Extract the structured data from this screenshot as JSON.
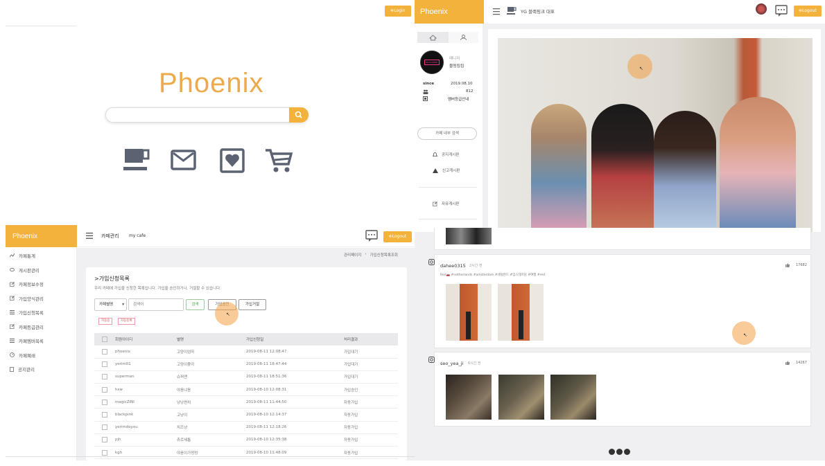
{
  "panelA": {
    "login_label": "Login",
    "logo_text": "Phoenix",
    "search_placeholder": "",
    "icons": [
      "coffee-cup-icon",
      "mail-icon",
      "heart-card-icon",
      "cart-icon"
    ]
  },
  "panelB": {
    "brand": "Phoenix",
    "cafe_title": "YG 블랙핑크 대표",
    "logout_label": "Logout",
    "tabs": [
      "home-icon",
      "user-icon"
    ],
    "role_label": "매니저",
    "nickname": "블링킴킴",
    "since_label": "since",
    "since_date": "2019.08.10",
    "member_count": "812",
    "grade_link": "멤버등급안내",
    "search_button": "카페 내부 검색",
    "board_notice": "공지게시판",
    "board_report": "신고게시판",
    "board_free": "자유게시판"
  },
  "panelC": {
    "brand": "Phoenix",
    "header_title": "카페관리",
    "header_sub": "my cafe",
    "logout_label": "Logout",
    "menu": [
      "카페통계",
      "게시판관리",
      "카페정보수정",
      "가입양식관리",
      "가입신청목록",
      "카페등급관리",
      "카페멤버목록",
      "카페폐쇄",
      "공지관리"
    ],
    "breadcrumb_1": "관리페이지",
    "breadcrumb_sep": "›",
    "breadcrumb_2": "가입신청목록조회",
    "section_title": ">가입신청목록",
    "section_desc": "우리 카페에 가입을 신청한 목록입니다. 가입을 승인하거나, 거절할 수 있습니다.",
    "filter_select": "카페별명",
    "search_placeholder": "검색어",
    "search_btn": "검색",
    "approve_btn": "가입승인",
    "reject_btn": "가입거절",
    "tag_1": "자동승",
    "tag_2": "자동등록",
    "columns": [
      "회원아이디",
      "별명",
      "가입신청일",
      "처리결과"
    ],
    "rows": [
      [
        "phoenix",
        "고양이엄마",
        "2019-08-11 12:08:47",
        "가입대기"
      ],
      [
        "yerim01",
        "고양이좋아",
        "2019-08-11 18:47:44",
        "가입대기"
      ],
      [
        "superman",
        "슈퍼맨",
        "2019-08-11 18:51:36",
        "가입대기"
      ],
      [
        "hsw",
        "야옹냐옹",
        "2019-08-10 12:08:31",
        "가입승인"
      ],
      [
        "magicZINI",
        "냥냥펀치",
        "2019-08-11 11:44:50",
        "자동가입"
      ],
      [
        "blackpink",
        "고냥이",
        "2019-08-10 12:14:37",
        "자동가입"
      ],
      [
        "yerimdoyou",
        "치즈냥",
        "2019-08-11 12:18:26",
        "자동가입"
      ],
      [
        "pjh",
        "츄르세톱",
        "2019-08-10 12:35:38",
        "자동가입"
      ],
      [
        "kgh",
        "야옹이가멍멍",
        "2019-08-10 11:48:09",
        "자동가입"
      ]
    ]
  },
  "panelD": {
    "post1_user": "dahee0315",
    "post1_time": "2시간 전",
    "post1_likes": "17682",
    "post1_tags": "Red🚗 #netherlands #amsterdam #네덜란드 #암스테르담 #여행 #red",
    "post2_user": "seo_yea_ji",
    "post2_time": "6시간 전",
    "post2_likes": "14267"
  },
  "colors": {
    "accent": "#f2b23c",
    "logo": "#ecaa4a"
  }
}
